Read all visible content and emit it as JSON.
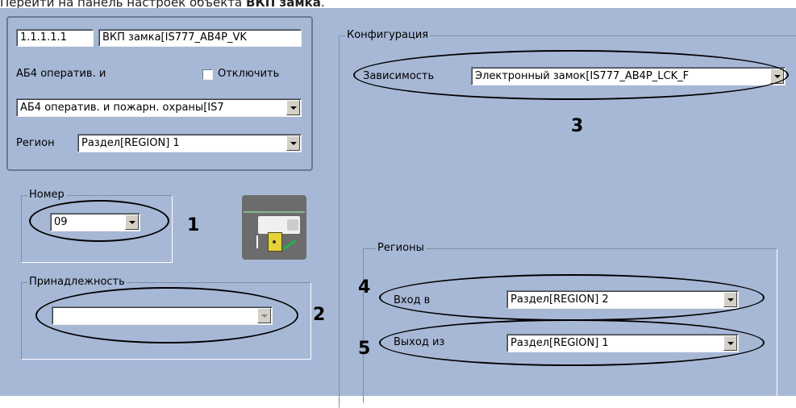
{
  "caption": {
    "prefix": "Перейти на панель настроек объекта ",
    "bold": "ВКП замка",
    "suffix": "."
  },
  "object": {
    "id_value": "1.1.1.1.1",
    "name_value": "ВКП замка[IS777_AB4P_VK",
    "parent_label": "АБ4 оператив. и",
    "disable_label": "Отключить",
    "parent_combo_value": "АБ4 оператив. и пожарн. охраны[IS7",
    "region_label": "Регион",
    "region_value": "Раздел[REGION] 1"
  },
  "number_group": {
    "legend": "Номер",
    "value": "09"
  },
  "membership_group": {
    "legend": "Принадлежность",
    "value": ""
  },
  "configuration": {
    "legend": "Конфигурация",
    "dependency_label": "Зависимость",
    "dependency_value": "Электронный замок[IS777_AB4P_LCK_F"
  },
  "regions": {
    "legend": "Регионы",
    "entry_label": "Вход в",
    "entry_value": "Раздел[REGION] 2",
    "exit_label": "Выход из",
    "exit_value": "Раздел[REGION] 1"
  },
  "callouts": [
    "1",
    "2",
    "3",
    "4",
    "5"
  ],
  "colors": {
    "panel_bg": "#a7b8d6",
    "button_face": "#d4d0c8"
  }
}
